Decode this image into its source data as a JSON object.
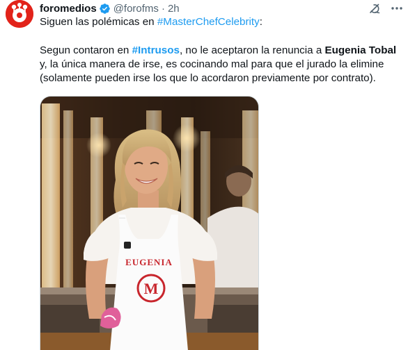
{
  "author": {
    "display_name": "foromedios",
    "handle": "@forofms",
    "separator": "·",
    "time": "2h",
    "avatar_icon": "forofms-logo-icon",
    "verified_icon": "verified-badge-icon"
  },
  "actions": {
    "grok_icon": "grok-icon",
    "more_icon": "more-options-icon"
  },
  "tweet": {
    "line1_prefix": "Siguen las polémicas en ",
    "line1_hashtag": "#MasterChefCelebrity",
    "line1_suffix": ":",
    "p2_part1": "Segun contaron en ",
    "p2_hashtag": "#Intrusos",
    "p2_part2": ", no le aceptaron la renuncia a ",
    "p2_name": "Eugenia Tobal",
    "p2_part3": " y, la única manera de irse, es cocinando mal para que el jurado la elimine (solamente pueden irse los que lo acordaron previamente por contrato)."
  },
  "media": {
    "description_icon": "tweet-photo",
    "apron_name": "EUGENIA",
    "apron_logo_letter": "M"
  },
  "colors": {
    "link": "#1d9bf0",
    "text": "#0f1419",
    "secondary": "#536471",
    "avatar_bg": "#e2231a",
    "apron_red": "#c8262d"
  }
}
